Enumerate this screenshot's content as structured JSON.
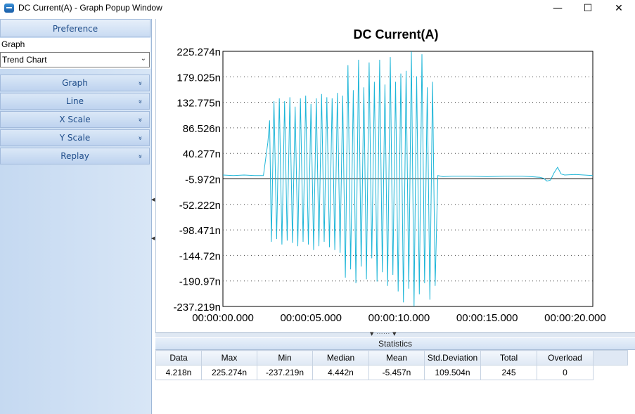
{
  "window": {
    "title": "DC Current(A) - Graph Popup Window",
    "min_glyph": "—",
    "max_glyph": "☐",
    "close_glyph": "✕"
  },
  "sidebar": {
    "preference_label": "Preference",
    "property_label": "Graph",
    "graph_type_value": "Trend Chart",
    "groups": [
      {
        "label": "Graph"
      },
      {
        "label": "Line"
      },
      {
        "label": "X Scale"
      },
      {
        "label": "Y Scale"
      },
      {
        "label": "Replay"
      }
    ],
    "expand_glyph": "»"
  },
  "chart_data": {
    "type": "line",
    "title": "DC Current(A)",
    "xlabel": "",
    "ylabel": "",
    "x_ticks": [
      "00:00:00.000",
      "00:00:05.000",
      "00:00:10.000",
      "00:00:15.000",
      "00:00:20.000"
    ],
    "x_range_seconds": [
      0,
      21
    ],
    "y_ticks": [
      "225.274n",
      "179.025n",
      "132.775n",
      "86.526n",
      "40.277n",
      "-5.972n",
      "-52.222n",
      "-98.471n",
      "-144.72n",
      "-190.97n",
      "-237.219n"
    ],
    "ylim": [
      -237.219,
      225.274
    ],
    "y_unit": "n",
    "reference_line": -5.972,
    "grid": "horizontal-dotted",
    "line_color": "#1fb6d8",
    "series": [
      {
        "x": [
          0.0,
          0.6,
          1.2,
          1.8,
          2.3,
          2.55,
          2.65,
          2.75,
          2.9,
          3.05,
          3.2,
          3.35,
          3.5,
          3.65,
          3.8,
          3.95,
          4.1,
          4.25,
          4.4,
          4.55,
          4.7,
          4.85,
          5.0,
          5.15,
          5.3,
          5.45,
          5.6,
          5.75,
          5.9,
          6.05,
          6.2,
          6.35,
          6.5,
          6.65,
          6.8,
          6.95,
          7.1,
          7.25,
          7.4,
          7.55,
          7.7,
          7.85,
          8.0,
          8.15,
          8.3,
          8.45,
          8.6,
          8.75,
          8.9,
          9.05,
          9.2,
          9.35,
          9.5,
          9.65,
          9.8,
          9.95,
          10.1,
          10.25,
          10.4,
          10.55,
          10.7,
          10.85,
          11.0,
          11.15,
          11.3,
          11.45,
          11.6,
          11.75,
          11.9,
          12.05,
          12.2,
          12.5,
          13.0,
          14.0,
          15.0,
          16.0,
          17.0,
          17.5,
          18.0,
          18.2,
          18.4,
          18.6,
          18.8,
          19.0,
          19.2,
          19.4,
          20.0,
          21.0
        ],
        "values": [
          1,
          0,
          1,
          0,
          0,
          60,
          100,
          -120,
          135,
          -115,
          140,
          -125,
          135,
          -118,
          142,
          -122,
          125,
          -128,
          140,
          -120,
          145,
          -125,
          130,
          -135,
          140,
          -128,
          148,
          -120,
          142,
          -130,
          140,
          -135,
          150,
          -140,
          145,
          -185,
          200,
          -170,
          155,
          -195,
          210,
          -165,
          160,
          -188,
          205,
          -150,
          170,
          -192,
          210,
          -175,
          165,
          -200,
          215,
          -180,
          170,
          -210,
          185,
          -230,
          190,
          -205,
          225,
          -237,
          180,
          -215,
          220,
          -195,
          160,
          -225,
          170,
          -200,
          0,
          -2,
          -1,
          -1,
          -2,
          -1,
          -1,
          -2,
          -3,
          -5,
          -10,
          -8,
          5,
          15,
          3,
          1,
          2,
          0
        ]
      }
    ]
  },
  "statistics": {
    "caption": "Statistics",
    "columns": [
      "Data",
      "Max",
      "Min",
      "Median",
      "Mean",
      "Std.Deviation",
      "Total",
      "Overload"
    ],
    "values": [
      "4.218n",
      "225.274n",
      "-237.219n",
      "4.442n",
      "-5.457n",
      "109.504n",
      "245",
      "0"
    ]
  }
}
